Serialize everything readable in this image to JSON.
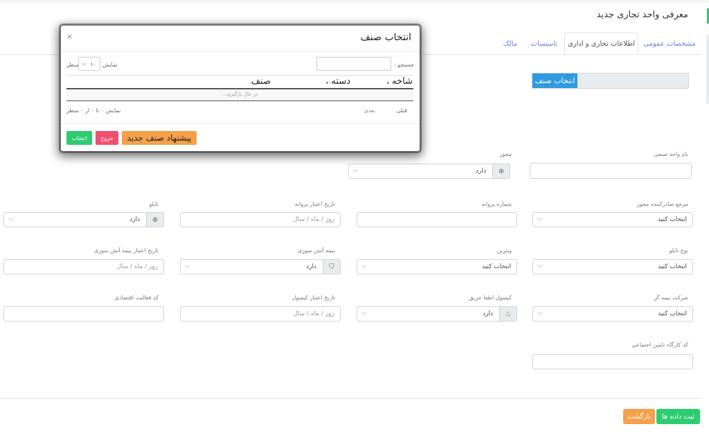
{
  "page": {
    "title": "معرفی واحد تجاری جدید",
    "tabs": [
      {
        "label": "مشخصات عمومی",
        "active": false
      },
      {
        "label": "اطلاعات تجاری و اداری",
        "active": true
      },
      {
        "label": "تاسیسات",
        "active": false
      },
      {
        "label": "مالک",
        "active": false
      }
    ],
    "select_class_button": "انتخاب صنف"
  },
  "form": {
    "permit": {
      "label": "مجوز",
      "value": "دارد"
    },
    "unit_name": {
      "label": "نام واحد صنفی"
    },
    "issuer": {
      "label": "مرجع صادرکننده مجوز",
      "value": "انتخاب کنید"
    },
    "license_number": {
      "label": "شماره پروانه"
    },
    "license_expiry": {
      "label": "تاریخ اعتبار پروانه",
      "placeholder": "روز / ماه / سال"
    },
    "sign": {
      "label": "تابلو",
      "value": "دارد"
    },
    "sign_type": {
      "label": "نوع تابلو",
      "value": "انتخاب کنید"
    },
    "showcase": {
      "label": "ویترین",
      "value": "انتخاب کنید"
    },
    "fire_insurance": {
      "label": "بیمه آتش سوزی",
      "value": "دارد"
    },
    "fire_insurance_expiry": {
      "label": "تاریخ اعتبار بیمه آتش سوزی",
      "placeholder": "روز / ماه / سال"
    },
    "insurance_company": {
      "label": "شرکت بیمه گر",
      "value": "انتخاب کنید"
    },
    "extinguisher": {
      "label": "کپسول اطفا حریق",
      "value": "دارد"
    },
    "extinguisher_expiry": {
      "label": "تاریخ اعتبار کپسول",
      "placeholder": "روز / ماه / سال"
    },
    "economic_code": {
      "label": "کد فعالیت اقتصادی"
    },
    "social_security_code": {
      "label": "کد کارگاه تامین اجتماعی"
    }
  },
  "actions": {
    "submit": "ثبت داده ها",
    "back": "بازگشت"
  },
  "modal": {
    "title": "انتخاب صنف",
    "close": "×",
    "search_label": "جستجو :",
    "length_show": "نمایش",
    "length_value": "۱۰",
    "length_rows": "سطر",
    "columns": [
      "شاخه ،",
      "دسته ،",
      "صنف"
    ],
    "loading": "در حال بارگیری...",
    "prev": "قبلی",
    "next": "بعدی",
    "info": "نمایش ۰ تا ۰ از ۰ سطر",
    "btn_select": "انتخاب",
    "btn_exit": "خروج",
    "btn_suggest": "پیشنهاد صنف جدید"
  }
}
